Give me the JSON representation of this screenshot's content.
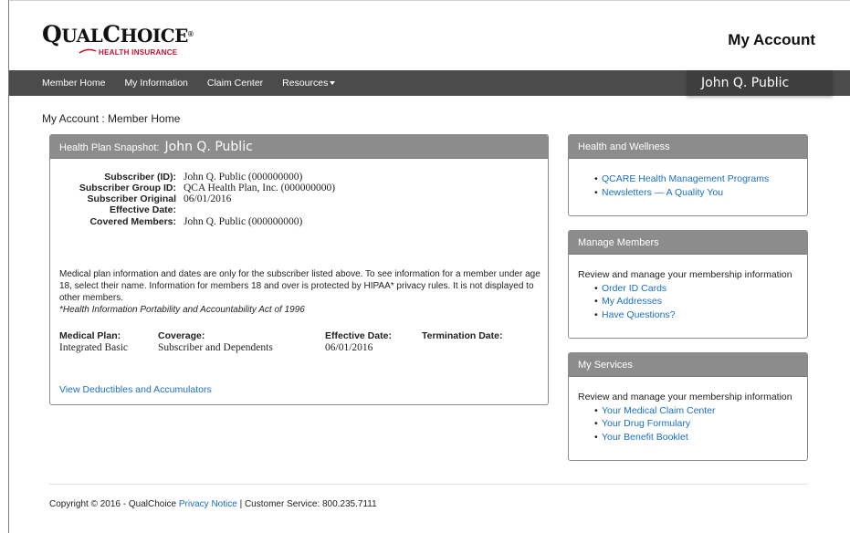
{
  "brand": {
    "logo_main_q": "Q",
    "logo_main_ual": "UAL",
    "logo_main_c": "C",
    "logo_main_hoice": "HOICE",
    "logo_reg": "®",
    "logo_sub": "HEALTH INSURANCE",
    "accent_color": "#c8102e"
  },
  "header": {
    "title": "My Account"
  },
  "nav": {
    "items": [
      {
        "label": "Member Home"
      },
      {
        "label": "My Information"
      },
      {
        "label": "Claim Center"
      },
      {
        "label": "Resources"
      }
    ],
    "user_name": "John Q. Public",
    "bar_color": "#4b4b4b"
  },
  "breadcrumb": "My Account : Member Home",
  "snapshot": {
    "heading_label": "Health Plan Snapshot:",
    "heading_name": "John Q. Public",
    "fields": [
      {
        "label": "Subscriber (ID):",
        "value": "John Q. Public (000000000)"
      },
      {
        "label": "Subscriber Group ID:",
        "value": "QCA Health Plan, Inc. (000000000)"
      },
      {
        "label": "Subscriber Original",
        "value": "06/01/2016"
      },
      {
        "label": "Effective Date:",
        "value": ""
      },
      {
        "label": "Covered Members:",
        "value": "John Q. Public (000000000)"
      }
    ],
    "note": "Medical plan information and dates are only for the subscriber listed above. To see information for a member under age 18, select their name. Information for members 18 and over is protected by HIPAA* privacy rules. It is not displayed to other members.",
    "note_footnote": "*Health Information Portability and Accountability Act of 1996",
    "plan": {
      "medical_plan_label": "Medical Plan:",
      "medical_plan_value": "Integrated Basic",
      "coverage_label": "Coverage:",
      "coverage_value": "Subscriber and Dependents",
      "effective_label": "Effective Date:",
      "effective_value": "06/01/2016",
      "termination_label": "Termination Date:",
      "termination_value": ""
    },
    "deductibles_link": "View Deductibles and Accumulators"
  },
  "health_wellness": {
    "heading": "Health and Wellness",
    "links": [
      "QCARE Health Management Programs",
      "Newsletters — A Quality You"
    ]
  },
  "manage_members": {
    "heading": "Manage Members",
    "intro": "Review and manage your membership information",
    "links": [
      "Order ID Cards",
      "My Addresses",
      "Have Questions?"
    ]
  },
  "my_services": {
    "heading": "My Services",
    "intro": "Review and manage your membership information",
    "links": [
      "Your Medical Claim Center",
      "Your Drug Formulary",
      "Your Benefit Booklet"
    ]
  },
  "footer": {
    "copyright": "Copyright © 2016 - QualChoice ",
    "privacy_link": "Privacy Notice",
    "service": " | Customer Service: 800.235.7111"
  },
  "link_color": "#1a6fc4"
}
